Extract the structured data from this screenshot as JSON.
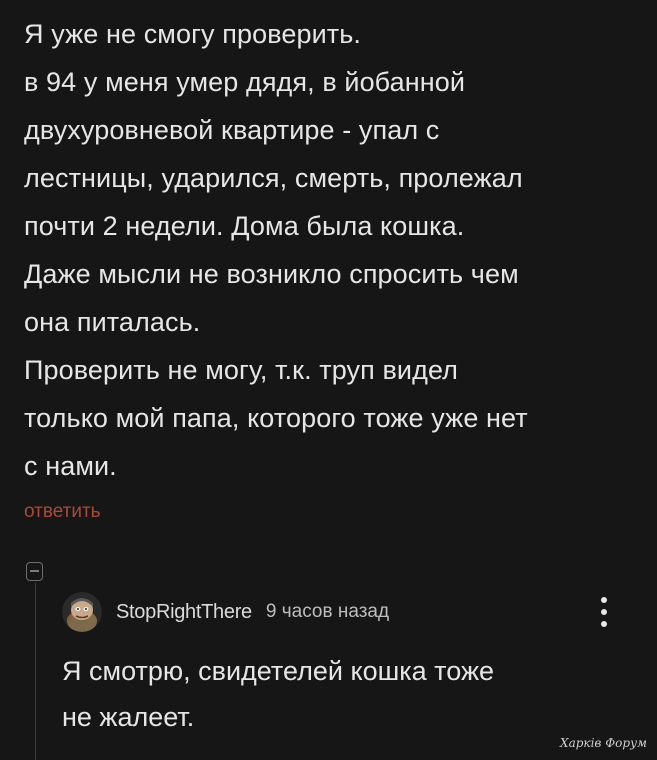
{
  "comment": {
    "lines": [
      "Я уже не смогу проверить.",
      "в 94 у меня умер дядя, в йобанной",
      "двухуровневой квартире - упал с",
      "лестницы, ударился, смерть, пролежал",
      "почти 2 недели. Дома была кошка.",
      "Даже мысли не возникло спросить чем",
      "она питалась.",
      "Проверить не могу, т.к. труп видел",
      "только мой папа, которого тоже уже нет",
      "с нами."
    ],
    "reply_label": "ответить"
  },
  "reply": {
    "username": "StopRightThere",
    "timestamp": "9 часов назад",
    "lines": [
      "Я смотрю, свидетелей кошка тоже",
      "не жалеет."
    ],
    "avatar_icon": "cartoon-character-avatar-icon",
    "menu_icon": "vertical-ellipsis-icon"
  },
  "watermark": "Харків Форум",
  "colors": {
    "background": "#161616",
    "text": "#e6e6e6",
    "reply_link": "#a94a3a",
    "thread_line": "#3f3f3f"
  }
}
